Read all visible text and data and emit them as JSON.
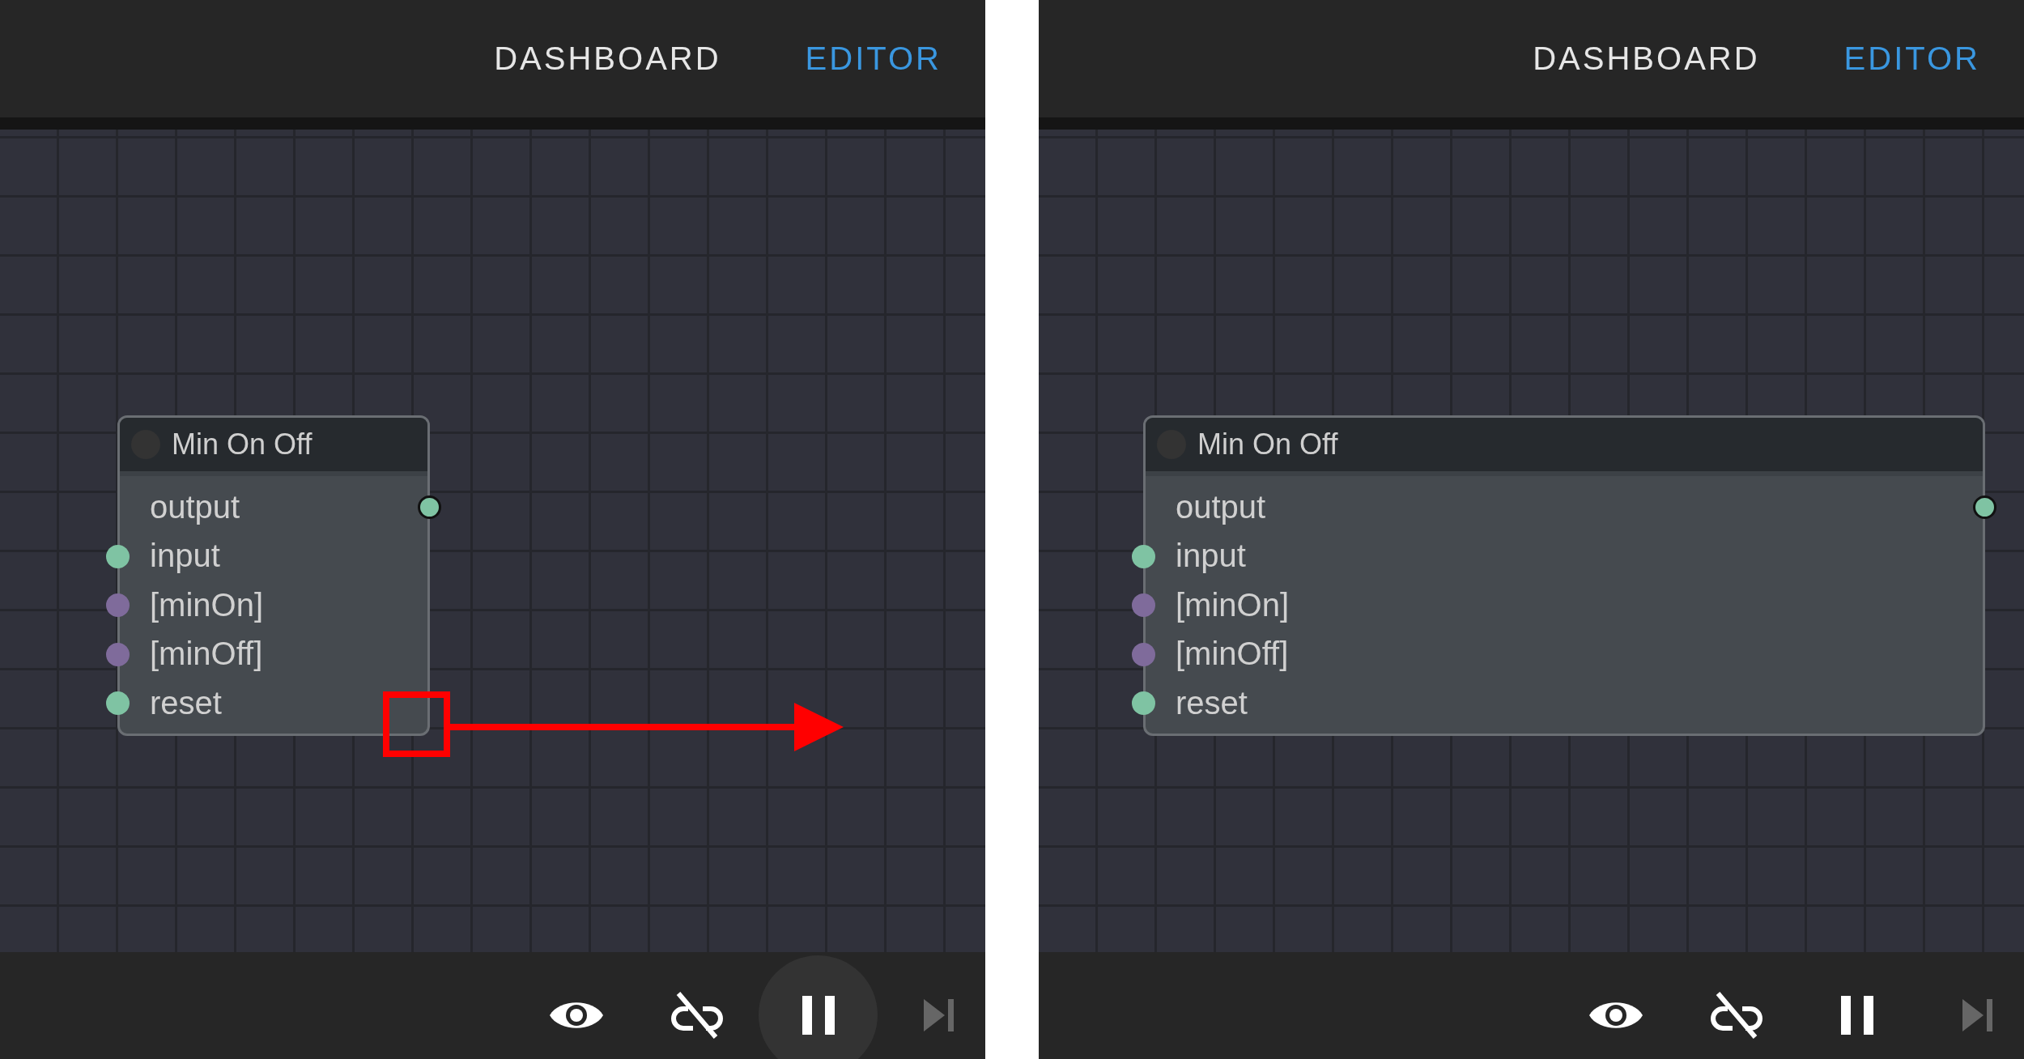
{
  "panels": [
    {
      "tabs": [
        {
          "label": "DASHBOARD",
          "selected": false
        },
        {
          "label": "EDITOR",
          "selected": true
        }
      ],
      "node": {
        "title": "Min On Off",
        "resized": false,
        "slots": [
          {
            "label": "output",
            "kind": "output",
            "color": "#7fc3a3"
          },
          {
            "label": "input",
            "kind": "input",
            "color": "#7fc3a3"
          },
          {
            "label": "[minOn]",
            "kind": "input",
            "color": "#7f6b9b"
          },
          {
            "label": "[minOff]",
            "kind": "input",
            "color": "#7f6b9b"
          },
          {
            "label": "reset",
            "kind": "input",
            "color": "#7fc3a3"
          }
        ]
      },
      "resize_hint": true,
      "toolbar": [
        {
          "kind": "eye",
          "highlighted": false,
          "disabled": false
        },
        {
          "kind": "link-off",
          "highlighted": false,
          "disabled": false
        },
        {
          "kind": "pause",
          "highlighted": true,
          "disabled": false
        },
        {
          "kind": "step",
          "highlighted": false,
          "disabled": true
        }
      ]
    },
    {
      "tabs": [
        {
          "label": "DASHBOARD",
          "selected": false
        },
        {
          "label": "EDITOR",
          "selected": true
        }
      ],
      "node": {
        "title": "Min On Off",
        "resized": true,
        "slots": [
          {
            "label": "output",
            "kind": "output",
            "color": "#7fc3a3"
          },
          {
            "label": "input",
            "kind": "input",
            "color": "#7fc3a3"
          },
          {
            "label": "[minOn]",
            "kind": "input",
            "color": "#7f6b9b"
          },
          {
            "label": "[minOff]",
            "kind": "input",
            "color": "#7f6b9b"
          },
          {
            "label": "reset",
            "kind": "input",
            "color": "#7fc3a3"
          }
        ]
      },
      "resize_hint": false,
      "toolbar": [
        {
          "kind": "eye",
          "highlighted": false,
          "disabled": false
        },
        {
          "kind": "link-off",
          "highlighted": false,
          "disabled": false
        },
        {
          "kind": "pause",
          "highlighted": false,
          "disabled": false
        },
        {
          "kind": "step",
          "highlighted": false,
          "disabled": true
        }
      ]
    }
  ]
}
